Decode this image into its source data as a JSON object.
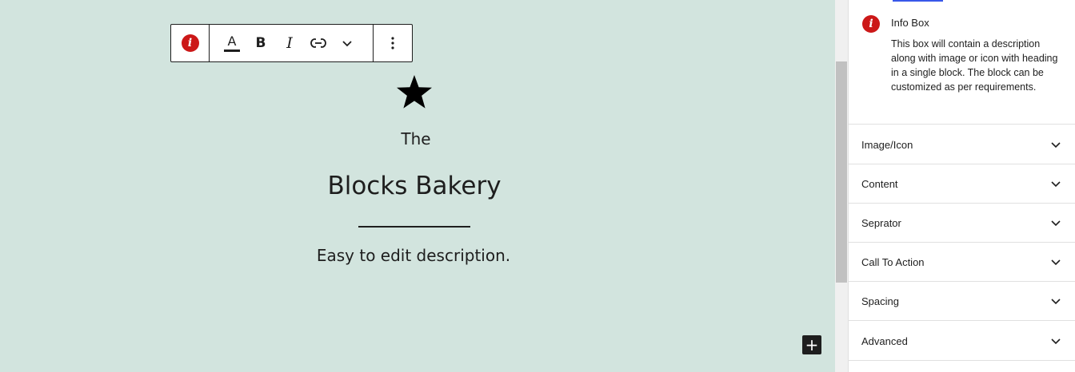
{
  "toolbar": {
    "block_icon": "info-icon",
    "text_color_label": "A",
    "bold_label": "B",
    "italic_label": "I",
    "link_icon": "link-icon",
    "more_rich_text_icon": "chevron-down-icon",
    "options_icon": "more-vertical-icon"
  },
  "infobox": {
    "icon": "star-icon",
    "pre_title": "The",
    "title": "Blocks Bakery",
    "description": "Easy to edit description."
  },
  "add_block_label": "+",
  "sidebar": {
    "block_card": {
      "badge_glyph": "i",
      "title": "Info Box",
      "description": "This box will contain a description along with image or icon with heading in a single block. The block can be customized as per requirements."
    },
    "panels": [
      {
        "label": "Image/Icon"
      },
      {
        "label": "Content"
      },
      {
        "label": "Seprator"
      },
      {
        "label": "Call To Action"
      },
      {
        "label": "Spacing"
      },
      {
        "label": "Advanced"
      }
    ]
  },
  "colors": {
    "canvas_bg": "#d2e4de",
    "info_badge": "#cc1818",
    "text": "#1e1e1e",
    "accent": "#3858e9"
  }
}
